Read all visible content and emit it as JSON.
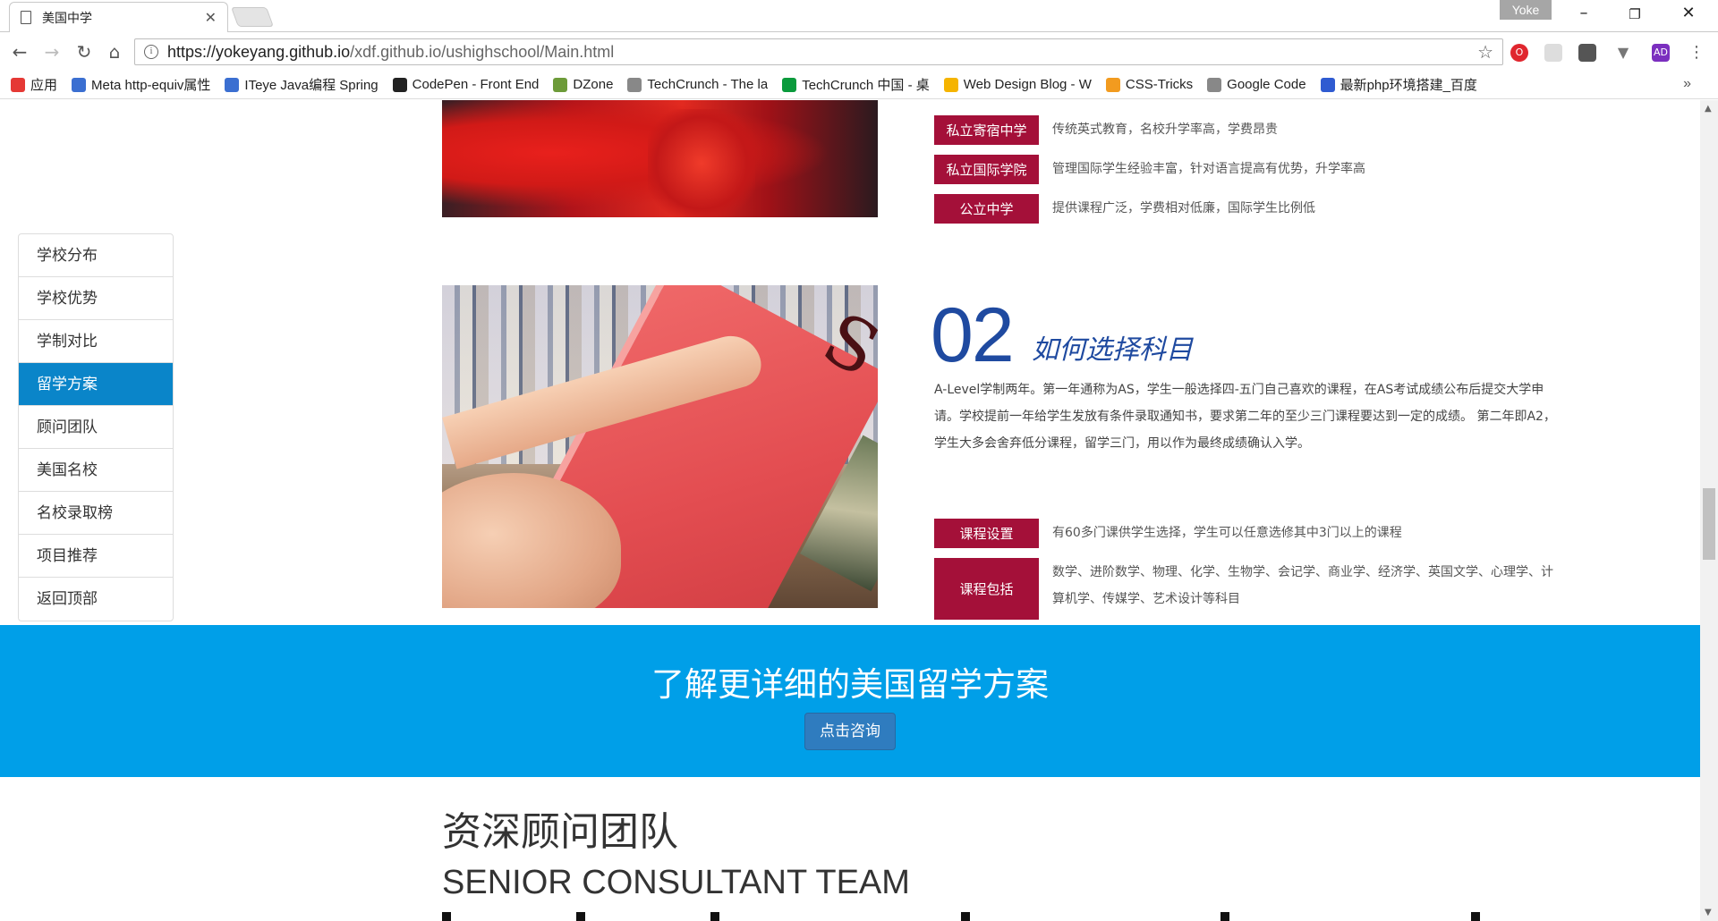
{
  "browser": {
    "tab_title": "美国中学",
    "profile_name": "Yoke",
    "url_host": "https://yokeyang.github.io",
    "url_path": "/xdf.github.io/ushighschool/Main.html",
    "bookmarks": [
      {
        "label": "应用",
        "icon": "apps-grid-icon",
        "color": "#e53935"
      },
      {
        "label": "Meta http-equiv属性",
        "icon": "ie-bookmark-icon",
        "color": "#3b6fd1"
      },
      {
        "label": "ITeye Java编程 Spring",
        "icon": "iteye-bookmark-icon",
        "color": "#3b6fd1"
      },
      {
        "label": "CodePen - Front End",
        "icon": "codepen-icon",
        "color": "#222222"
      },
      {
        "label": "DZone",
        "icon": "dzone-icon",
        "color": "#6d9b39"
      },
      {
        "label": "TechCrunch - The la",
        "icon": "page-icon",
        "color": "#888888"
      },
      {
        "label": "TechCrunch 中国 - 桌",
        "icon": "techcrunch-icon",
        "color": "#0a9a3c"
      },
      {
        "label": "Web Design Blog - W",
        "icon": "webdesign-icon",
        "color": "#f5b400"
      },
      {
        "label": "CSS-Tricks",
        "icon": "css-tricks-icon",
        "color": "#f29b1f"
      },
      {
        "label": "Google Code",
        "icon": "page-icon",
        "color": "#888888"
      },
      {
        "label": "最新php环境搭建_百度",
        "icon": "baidu-icon",
        "color": "#2f5bd1"
      }
    ]
  },
  "sidenav": {
    "items": [
      {
        "label": "学校分布",
        "active": false
      },
      {
        "label": "学校优势",
        "active": false
      },
      {
        "label": "学制对比",
        "active": false
      },
      {
        "label": "留学方案",
        "active": true
      },
      {
        "label": "顾问团队",
        "active": false
      },
      {
        "label": "美国名校",
        "active": false
      },
      {
        "label": "名校录取榜",
        "active": false
      },
      {
        "label": "项目推荐",
        "active": false
      },
      {
        "label": "返回顶部",
        "active": false
      }
    ]
  },
  "section1": {
    "rows": [
      {
        "tag": "私立寄宿中学",
        "desc": "传统英式教育，名校升学率高，学费昂贵"
      },
      {
        "tag": "私立国际学院",
        "desc": "管理国际学生经验丰富，针对语言提高有优势，升学率高"
      },
      {
        "tag": "公立中学",
        "desc": "提供课程广泛，学费相对低廉，国际学生比例低"
      }
    ]
  },
  "section2": {
    "number": "02",
    "title": "如何选择科目",
    "paragraph": "A-Level学制两年。第一年通称为AS，学生一般选择四-五门自己喜欢的课程，在AS考试成绩公布后提交大学申请。学校提前一年给学生发放有条件录取通知书，要求第二年的至少三门课程要达到一定的成绩。 第二年即A2，学生大多会舍弃低分课程，留学三门，用以作为最终成绩确认入学。",
    "rows": [
      {
        "tag": "课程设置",
        "desc": "有60多门课供学生选择，学生可以任意选修其中3门以上的课程"
      },
      {
        "tag": "课程包括",
        "desc": "数学、进阶数学、物理、化学、生物学、会记学、商业学、经济学、英国文学、心理学、计算机学、传媒学、艺术设计等科目"
      }
    ]
  },
  "banner": {
    "title": "了解更详细的美国留学方案",
    "button": "点击咨询",
    "color": "#009fe8"
  },
  "team": {
    "title_cn": "资深顾问团队",
    "title_en": "SENIOR CONSULTANT TEAM"
  },
  "colors": {
    "accent_red": "#a41039",
    "accent_blue": "#1f4aa0",
    "nav_active": "#0a85c9"
  }
}
